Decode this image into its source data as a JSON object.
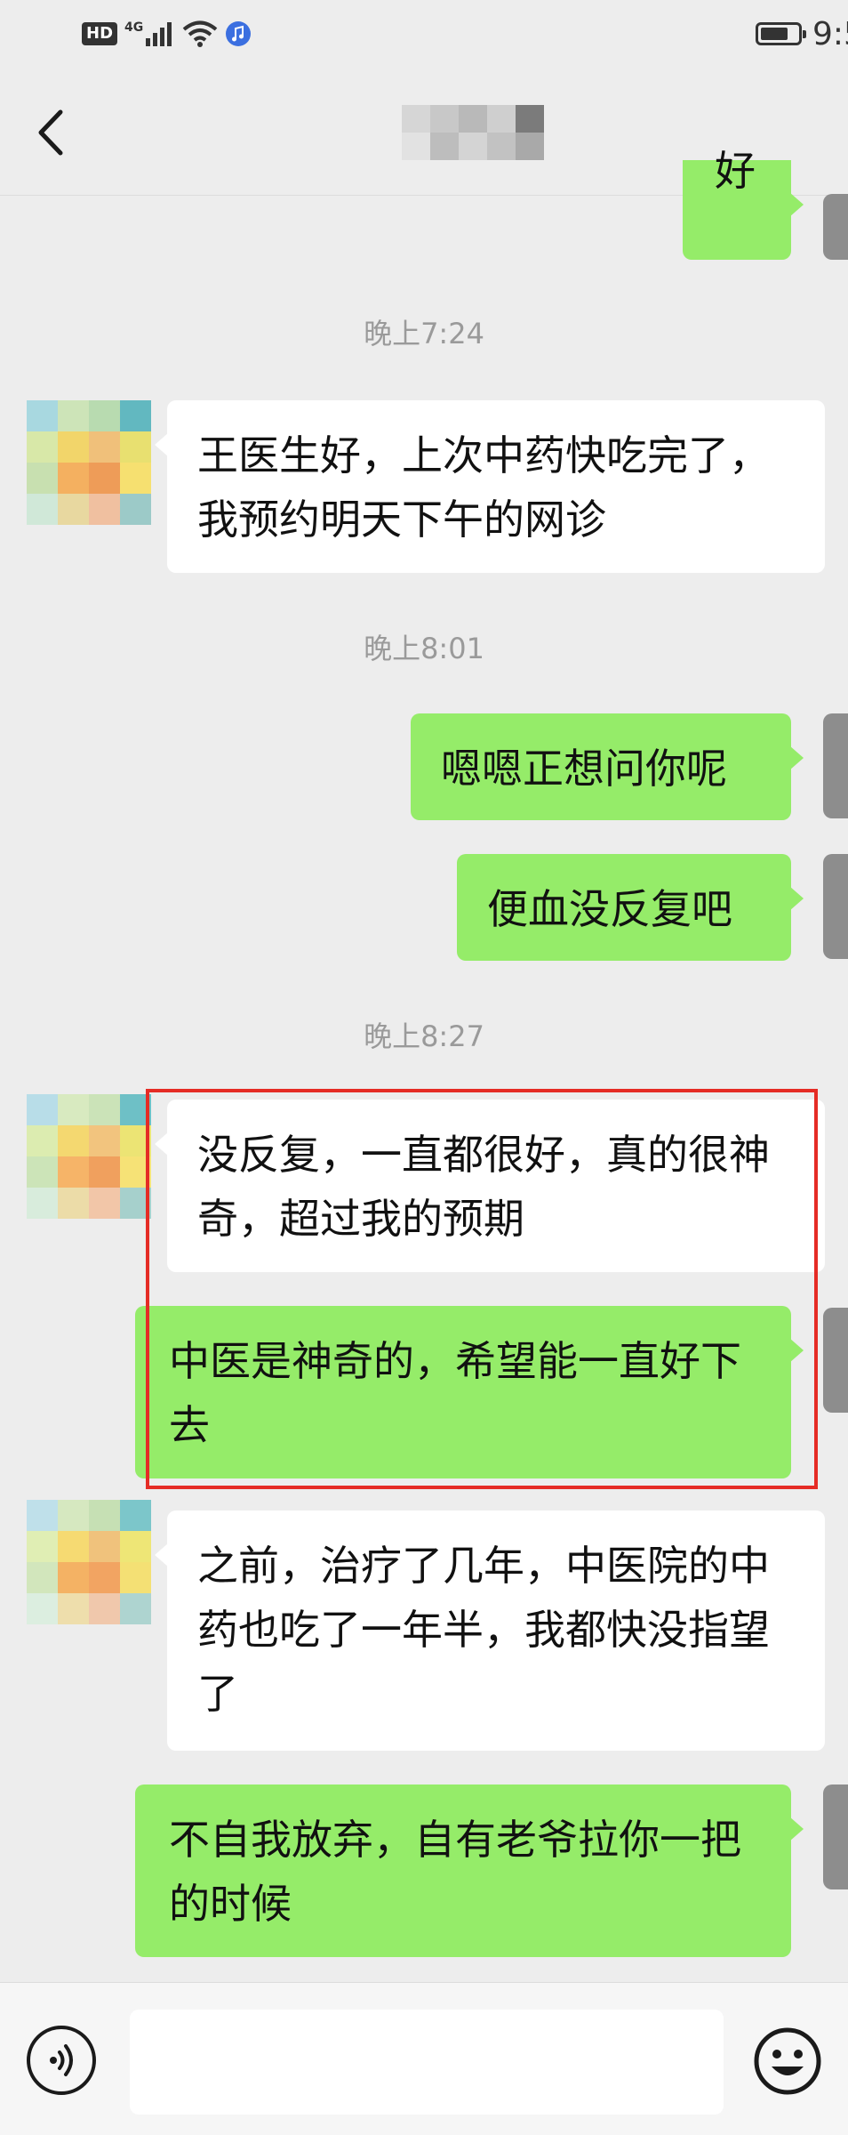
{
  "status_bar": {
    "network_badge": "HD",
    "network_type": "4G",
    "time": "9:5"
  },
  "header": {
    "back_icon": "chevron-left-icon",
    "contact_name": ""
  },
  "messages": [
    {
      "side": "out",
      "text": "好"
    },
    {
      "type": "timestamp",
      "text": "晚上7:24"
    },
    {
      "side": "in",
      "text": "王医生好，上次中药快吃完了，我预约明天下午的网诊"
    },
    {
      "type": "timestamp",
      "text": "晚上8:01"
    },
    {
      "side": "out",
      "text": "嗯嗯正想问你呢"
    },
    {
      "side": "out",
      "text": "便血没反复吧"
    },
    {
      "type": "timestamp",
      "text": "晚上8:27"
    },
    {
      "side": "in",
      "text": "没反复，一直都很好，真的很神奇，超过我的预期"
    },
    {
      "side": "out",
      "text": "中医是神奇的，希望能一直好下去"
    },
    {
      "side": "in",
      "text": "之前，治疗了几年，中医院的中药也吃了一年半，我都快没指望了"
    },
    {
      "side": "out",
      "text": "不自我放弃，自有老爷拉你一把的时候"
    }
  ],
  "input_bar": {
    "voice_icon": "voice-icon",
    "input_value": "",
    "emoji_icon": "emoji-icon"
  },
  "colors": {
    "background": "#ededed",
    "outgoing_bubble": "#95ec69",
    "incoming_bubble": "#ffffff",
    "highlight_border": "#e52c25",
    "timestamp_text": "#9a9a9a"
  }
}
